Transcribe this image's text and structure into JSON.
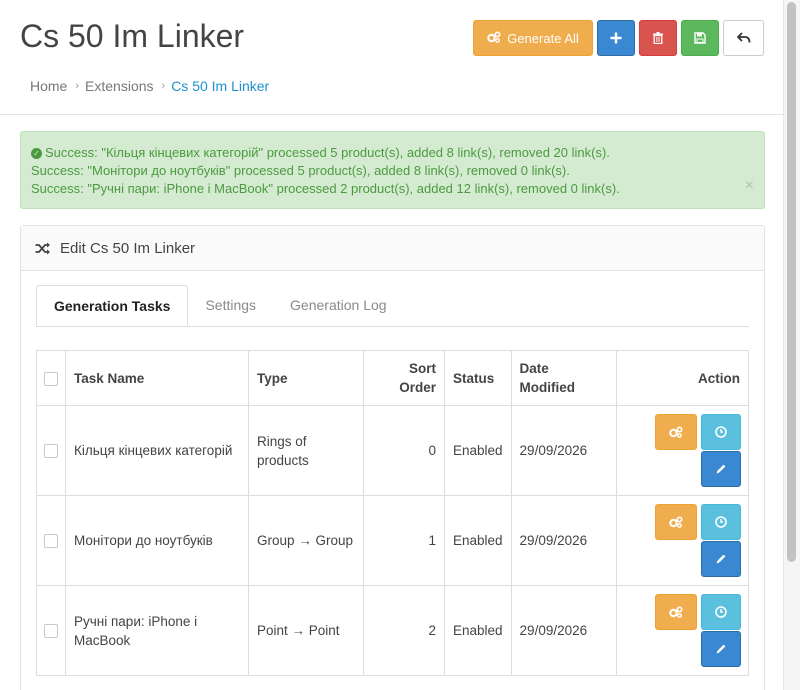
{
  "header": {
    "title": "Cs 50 Im Linker",
    "generate_all_label": "Generate All"
  },
  "breadcrumb": [
    {
      "label": "Home"
    },
    {
      "label": "Extensions"
    },
    {
      "label": "Cs 50 Im Linker"
    }
  ],
  "breadcrumb_sep": "›",
  "alert": {
    "lines": [
      "Success: \"Кільця кінцевих категорій\" processed 5 product(s), added 8 link(s), removed 20 link(s).",
      "Success: \"Монітори до ноутбуків\" processed 5 product(s), added 8 link(s), removed 0 link(s).",
      "Success: \"Ручні пари: iPhone і MacBook\" processed 2 product(s), added 12 link(s), removed 0 link(s)."
    ],
    "close": "×"
  },
  "panel": {
    "title": "Edit Cs 50 Im Linker"
  },
  "tabs": [
    {
      "label": "Generation Tasks",
      "active": true
    },
    {
      "label": "Settings",
      "active": false
    },
    {
      "label": "Generation Log",
      "active": false
    }
  ],
  "table": {
    "headers": {
      "task_name": "Task Name",
      "type": "Type",
      "sort_order_1": "Sort",
      "sort_order_2": "Order",
      "status": "Status",
      "date_1": "Date",
      "date_2": "Modified",
      "action": "Action"
    },
    "rows": [
      {
        "name": "Кільця кінцевих категорій",
        "type": "Rings of products",
        "sort": "0",
        "status": "Enabled",
        "date": "29/09/2026"
      },
      {
        "name": "Монітори до ноутбуків",
        "type": "Group → Group",
        "sort": "1",
        "status": "Enabled",
        "date": "29/09/2026"
      },
      {
        "name": "Ручні пари: iPhone і MacBook",
        "type": "Point → Point",
        "sort": "2",
        "status": "Enabled",
        "date": "29/09/2026"
      }
    ]
  },
  "colors": {
    "warning": "#f0ad4e",
    "primary": "#3a87d2",
    "danger": "#d9534f",
    "success": "#5cb85c",
    "info": "#5bc0de",
    "link": "#1e91cf",
    "alert_bg": "#d4ebd2",
    "alert_text": "#4c9a3f"
  },
  "icons": {
    "generate": "gears-icon",
    "add": "plus-icon",
    "delete": "trash-icon",
    "save": "floppy-icon",
    "back": "reply-icon",
    "panel": "shuffle-icon",
    "history": "clock-icon",
    "edit": "pencil-icon",
    "success": "check-circle-icon",
    "close": "close-icon"
  }
}
